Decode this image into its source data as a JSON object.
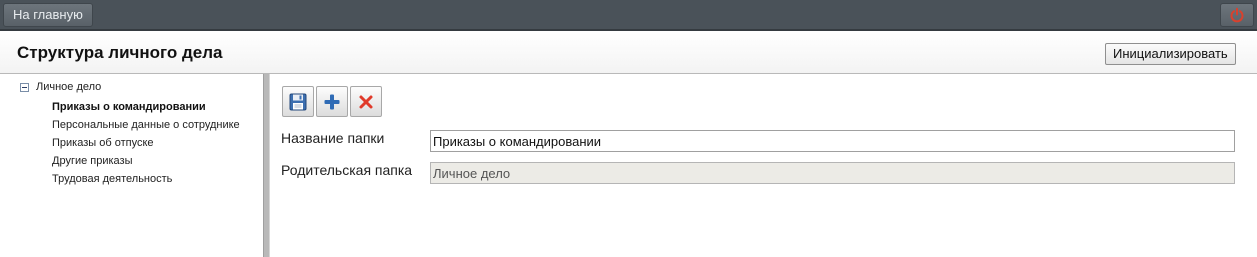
{
  "topbar": {
    "home_label": "На главную",
    "logout_icon": "power-icon",
    "logout_color": "#d9412d"
  },
  "header": {
    "title": "Структура личного дела",
    "init_label": "Инициализировать"
  },
  "tree": {
    "root_label": "Личное дело",
    "root_icon": "collapse-minus-icon",
    "items": [
      {
        "label": "Приказы о командировании",
        "active": true
      },
      {
        "label": "Персональные данные о сотруднике",
        "active": false
      },
      {
        "label": "Приказы об отпуске",
        "active": false
      },
      {
        "label": "Другие приказы",
        "active": false
      },
      {
        "label": "Трудовая деятельность",
        "active": false
      }
    ]
  },
  "toolbar": {
    "save_icon": "floppy-disk-icon",
    "add_icon": "plus-icon",
    "delete_icon": "red-x-icon"
  },
  "form": {
    "folder_name_label": "Название папки",
    "folder_name_value": "Приказы о командировании",
    "parent_folder_label": "Родительская папка",
    "parent_folder_value": "Личное дело"
  },
  "colors": {
    "topbar": "#4a5259",
    "splitter": "#b9b9b9",
    "add_icon": "#2f6bb5",
    "delete_icon": "#e03a2a"
  }
}
